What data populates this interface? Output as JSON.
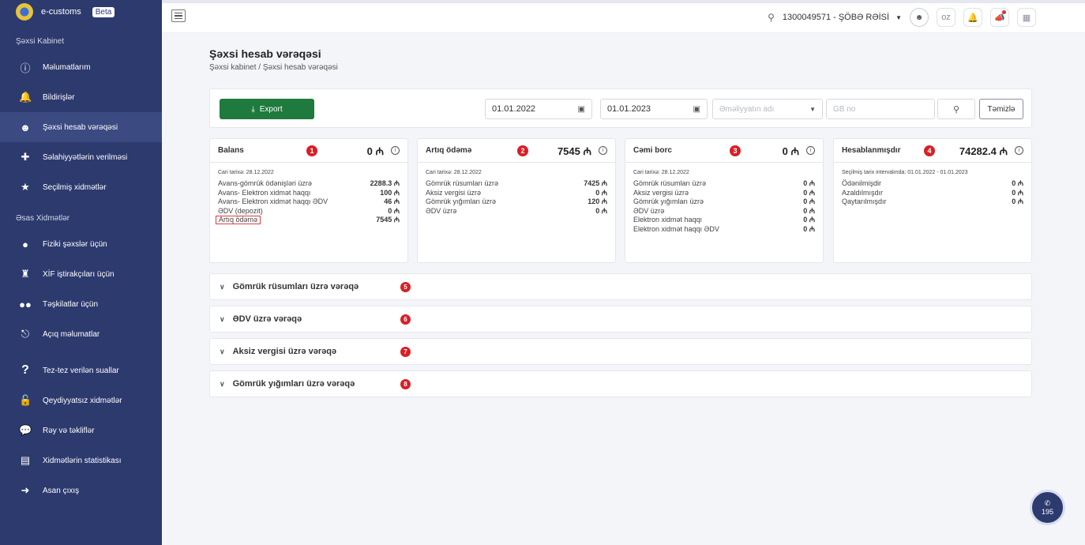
{
  "brand": {
    "name": "e-customs",
    "badge": "Beta"
  },
  "sidebar": {
    "section1": "Şəxsi Kabinet",
    "items1": [
      {
        "label": "Məlumatlarım",
        "icon": "info-icon"
      },
      {
        "label": "Bildirişlər",
        "icon": "bell-icon"
      },
      {
        "label": "Şəxsi hesab vərəqəsi",
        "icon": "user-circle-icon"
      },
      {
        "label": "Səlahiyyətlərin verilməsi",
        "icon": "user-plus-icon"
      },
      {
        "label": "Seçilmiş xidmətlər",
        "icon": "star-icon"
      }
    ],
    "section2": "Əsas Xidmətlər",
    "items2": [
      {
        "label": "Fiziki şəxslər üçün",
        "icon": "person-icon"
      },
      {
        "label": "XİF iştirakçıları üçün",
        "icon": "business-person-icon"
      },
      {
        "label": "Təşkilatlar üçün",
        "icon": "group-icon"
      },
      {
        "label": "Açıq məlumatlar",
        "icon": "network-icon"
      }
    ],
    "items3": [
      {
        "label": "Tez-tez verilən suallar",
        "icon": "question-icon"
      },
      {
        "label": "Qeydiyyatsız xidmətlər",
        "icon": "unlock-icon"
      },
      {
        "label": "Rəy və təkliflər",
        "icon": "chat-icon"
      },
      {
        "label": "Xidmətlərin statistikası",
        "icon": "stats-icon"
      },
      {
        "label": "Asan çıxış",
        "icon": "logout-icon"
      }
    ]
  },
  "topbar": {
    "user": "1300049571 - ŞÖBƏ RƏİSİ",
    "lang": "oz"
  },
  "page": {
    "title": "Şəxsi hesab vərəqəsi",
    "breadcrumb": "Şəxsi kabinet / Şəxsi hesab vərəqəsi"
  },
  "filters": {
    "export_label": "Export",
    "date_from": "01.01.2022",
    "date_to": "01.01.2023",
    "operation_placeholder": "Əməliyyatın adı",
    "gb_placeholder": "GB no",
    "clear_label": "Təmizlə"
  },
  "cards": [
    {
      "title": "Balans",
      "badge": "1",
      "total": "0 ₼",
      "date": "Cari tarixə: 28.12.2022",
      "rows": [
        {
          "k": "Avans-gömrük ödənişləri üzrə",
          "v": "2288.3 ₼"
        },
        {
          "k": "Avans- Elektron xidmət haqqı",
          "v": "100 ₼"
        },
        {
          "k": "Avans- Elektron xidmət haqqı ƏDV",
          "v": "46 ₼"
        },
        {
          "k": "ƏDV (depozit)",
          "v": "0 ₼"
        },
        {
          "k": "Artıq ödəmə",
          "v": "7545 ₼"
        }
      ]
    },
    {
      "title": "Artıq ödəmə",
      "badge": "2",
      "total": "7545 ₼",
      "date": "Cari tarixə: 28.12.2022",
      "rows": [
        {
          "k": "Gömrük rüsumları üzrə",
          "v": "7425 ₼"
        },
        {
          "k": "Aksiz vergisi üzrə",
          "v": "0 ₼"
        },
        {
          "k": "Gömrük yığımları üzrə",
          "v": "120 ₼"
        },
        {
          "k": "ƏDV üzrə",
          "v": "0 ₼"
        }
      ]
    },
    {
      "title": "Cəmi borc",
      "badge": "3",
      "total": "0 ₼",
      "date": "Cari tarixə: 28.12.2022",
      "rows": [
        {
          "k": "Gömrük rüsumları üzrə",
          "v": "0 ₼"
        },
        {
          "k": "Aksiz vergisi üzrə",
          "v": "0 ₼"
        },
        {
          "k": "Gömrük yığımları üzrə",
          "v": "0 ₼"
        },
        {
          "k": "ƏDV üzrə",
          "v": "0 ₼"
        },
        {
          "k": "Elektron xidmət haqqı",
          "v": "0 ₼"
        },
        {
          "k": "Elektron xidmət haqqı ƏDV",
          "v": "0 ₼"
        }
      ]
    },
    {
      "title": "Hesablanmışdır",
      "badge": "4",
      "total": "74282.4 ₼",
      "date": "Seçilmiş tarix intervalında: 01.01.2022 - 01.01.2023",
      "rows": [
        {
          "k": "Ödənilmişdir",
          "v": "0 ₼"
        },
        {
          "k": "Azaldılmışdır",
          "v": "0 ₼"
        },
        {
          "k": "Qaytarılmışdır",
          "v": "0 ₼"
        }
      ]
    }
  ],
  "accordions": [
    {
      "label": "Gömrük rüsumları üzrə vərəqə",
      "badge": "5"
    },
    {
      "label": "ƏDV üzrə vərəqə",
      "badge": "6"
    },
    {
      "label": "Aksiz vergisi üzrə vərəqə",
      "badge": "7"
    },
    {
      "label": "Gömrük yığımları üzrə vərəqə",
      "badge": "8"
    }
  ],
  "call": {
    "count": "195"
  }
}
